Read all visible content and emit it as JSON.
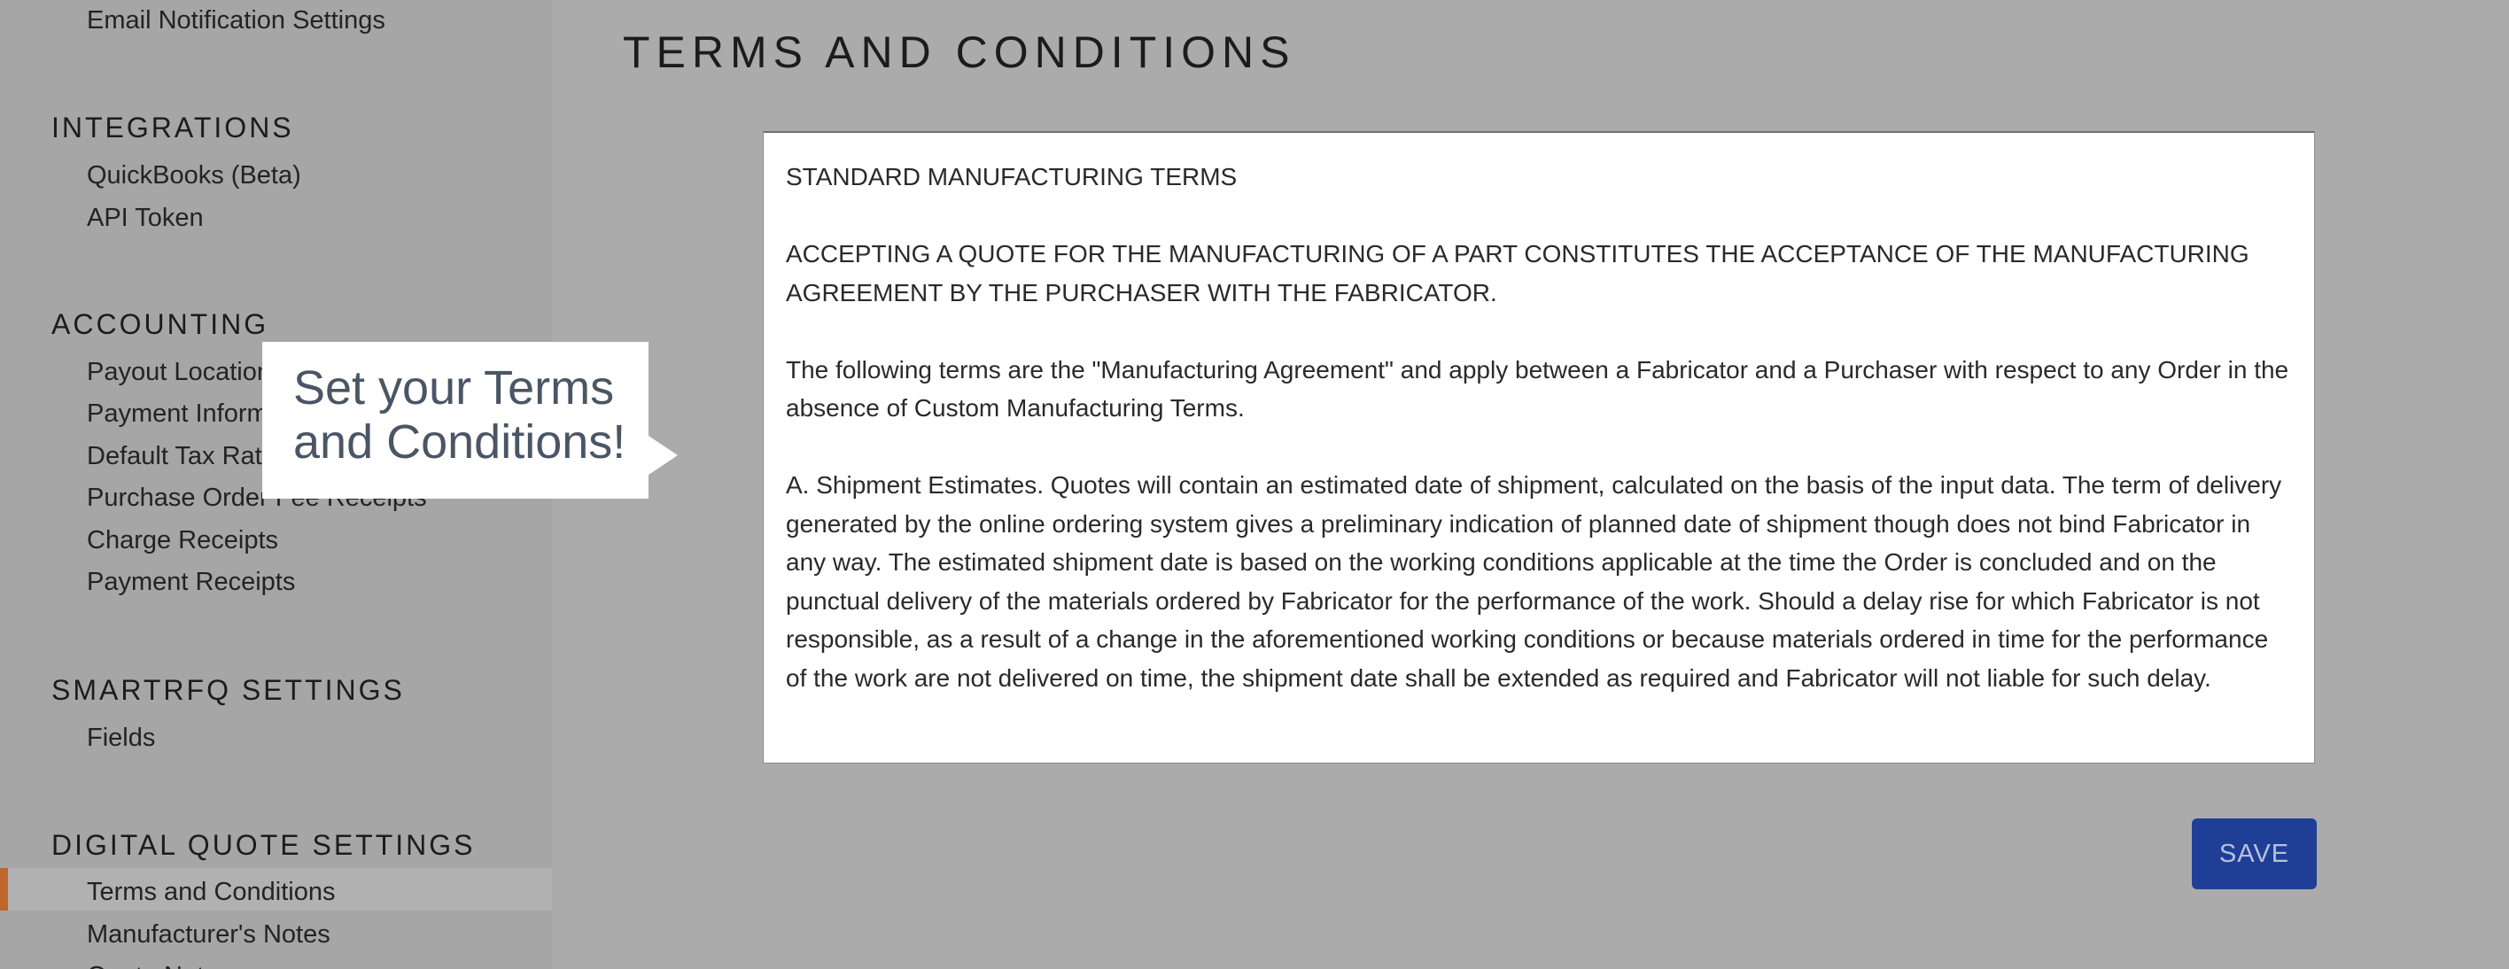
{
  "sidebar": {
    "top_item": "Email Notification Settings",
    "sections": [
      {
        "heading": "INTEGRATIONS",
        "items": [
          "QuickBooks (Beta)",
          "API Token"
        ]
      },
      {
        "heading": "ACCOUNTING",
        "items": [
          "Payout Locations",
          "Payment Information",
          "Default Tax Rates",
          "Purchase Order Fee Receipts",
          "Charge Receipts",
          "Payment Receipts"
        ]
      },
      {
        "heading": "SMARTRFQ SETTINGS",
        "items": [
          "Fields"
        ]
      },
      {
        "heading": "DIGITAL QUOTE SETTINGS",
        "items": [
          "Terms and Conditions",
          "Manufacturer's Notes",
          "Quote Notes"
        ]
      }
    ],
    "active_item": "Terms and Conditions"
  },
  "main": {
    "title": "TERMS AND CONDITIONS",
    "terms_paragraphs": [
      "STANDARD MANUFACTURING TERMS",
      "ACCEPTING A QUOTE FOR THE MANUFACTURING OF A PART CONSTITUTES THE ACCEPTANCE OF THE MANUFACTURING AGREEMENT BY THE PURCHASER WITH THE FABRICATOR.",
      "The following terms are the \"Manufacturing Agreement\" and apply between a Fabricator and a Purchaser with respect to any Order in the absence of Custom Manufacturing Terms.",
      "A. Shipment Estimates. Quotes will contain an estimated date of shipment, calculated on the basis of the input data. The term of delivery generated by the online ordering system gives a preliminary indication of planned date of shipment though does not bind Fabricator in any way. The estimated shipment date is based on the working conditions applicable at the time the Order is concluded and on the punctual delivery of the materials ordered by Fabricator for the performance of the work. Should a delay rise for which Fabricator is not responsible, as a result of a change in the aforementioned working conditions or because materials ordered in time for the performance of the work are not delivered on time, the shipment date shall be extended as required and Fabricator will not liable for such delay."
    ],
    "save_label": "SAVE"
  },
  "callout": {
    "line1": "Set your Terms",
    "line2": "and Conditions!"
  },
  "colors": {
    "overlay_background": "#ababab",
    "accent_bar": "#c0652c",
    "save_button": "#1f3f96",
    "callout_text": "#4a5565"
  }
}
